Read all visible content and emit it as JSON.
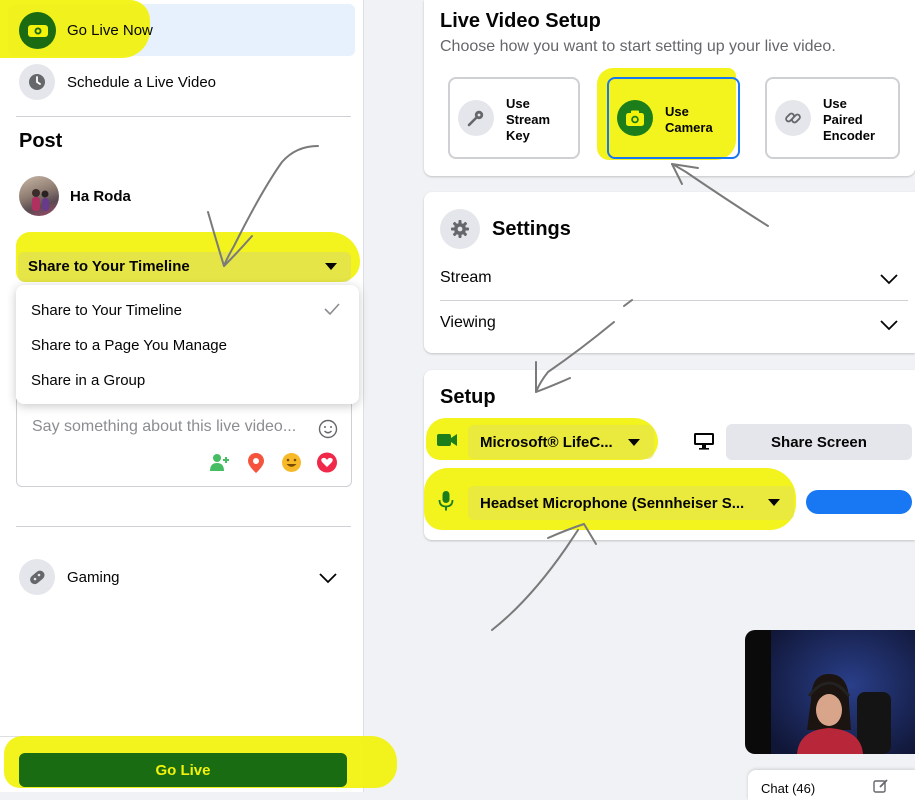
{
  "sidebar": {
    "go_live_now": "Go Live Now",
    "schedule": "Schedule a Live Video",
    "post_heading": "Post",
    "user_name": "Ha Roda",
    "share_select": "Share to Your Timeline",
    "share_options": [
      "Share to Your Timeline",
      "Share to a Page You Manage",
      "Share in a Group"
    ],
    "post_placeholder": "Say something about this live video...",
    "gaming": "Gaming",
    "go_live_button": "Go Live"
  },
  "setup_card": {
    "title": "Live Video Setup",
    "subtitle": "Choose how you want to start setting up your live video.",
    "options": [
      {
        "line1": "Use",
        "line2": "Stream",
        "line3": "Key"
      },
      {
        "line1": "Use",
        "line2": "Camera",
        "line3": ""
      },
      {
        "line1": "Use",
        "line2": "Paired",
        "line3": "Encoder"
      }
    ]
  },
  "settings_card": {
    "title": "Settings",
    "stream": "Stream",
    "viewing": "Viewing"
  },
  "devices_card": {
    "title": "Setup",
    "camera": "Microsoft® LifeC...",
    "share_screen": "Share Screen",
    "microphone": "Headset Microphone (Sennheiser S..."
  },
  "chat": {
    "label": "Chat (46)"
  },
  "colors": {
    "highlight": "#f2f20a",
    "go_live_green": "#1a6c12",
    "fb_blue": "#1877f2",
    "camera_green": "#1b7e1b"
  }
}
